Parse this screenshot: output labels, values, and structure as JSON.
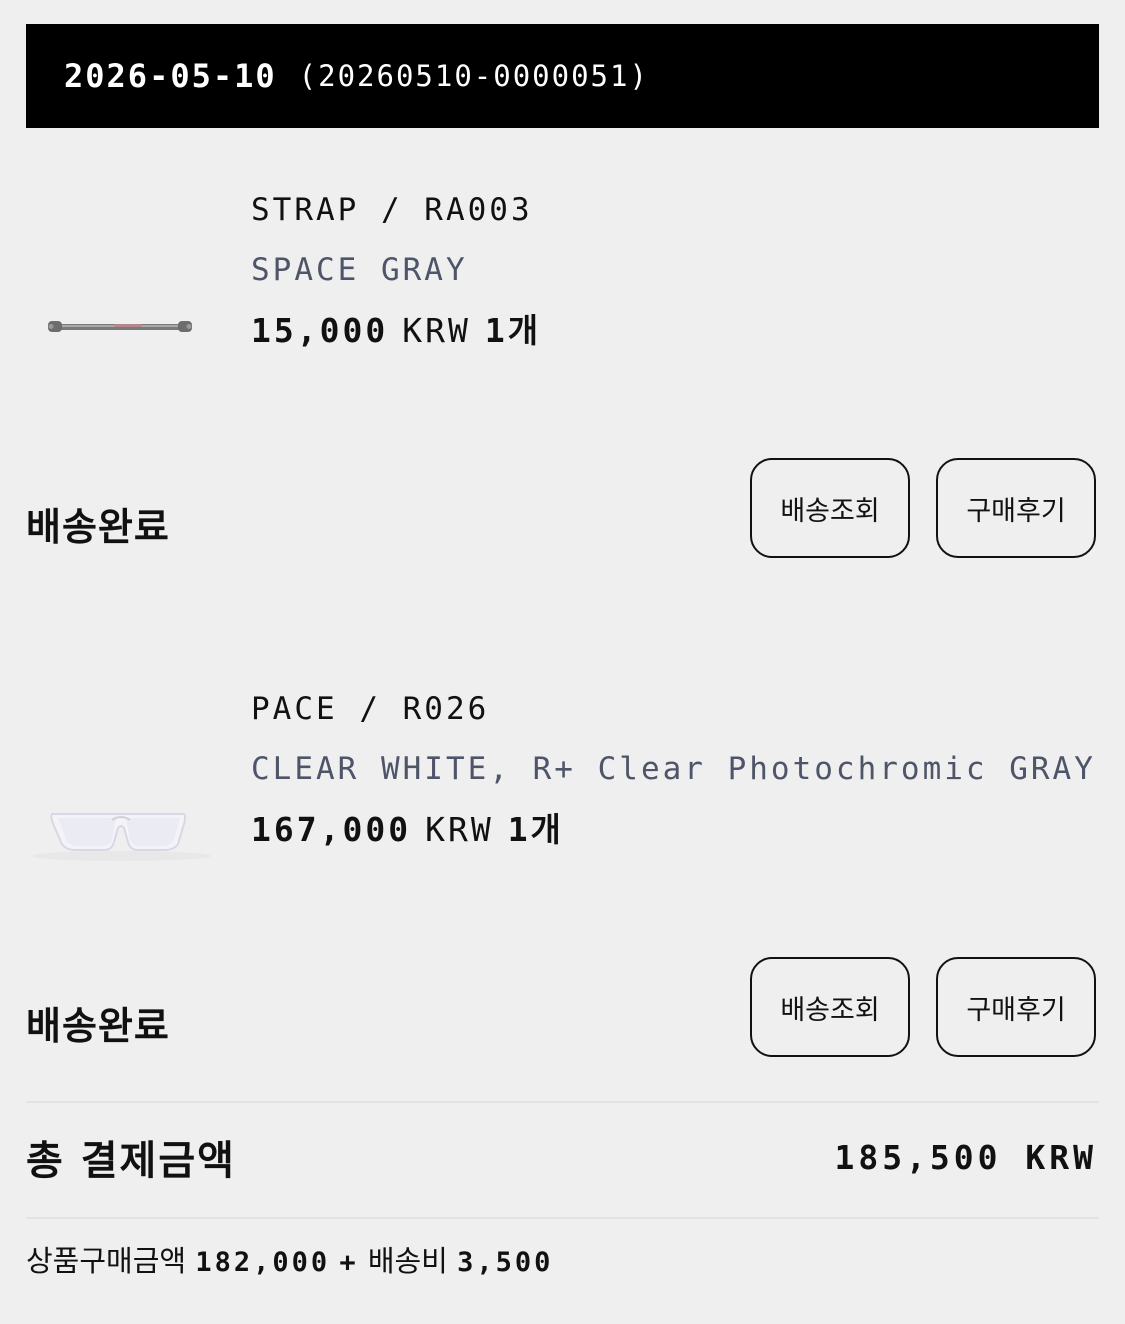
{
  "order": {
    "date": "2026-05-10",
    "number": "(20260510-0000051)"
  },
  "items": [
    {
      "name": "STRAP / RA003",
      "option": "SPACE GRAY",
      "price": "15,000",
      "currency": "KRW",
      "quantity": "1개",
      "thumbnail_icon": "strap-image",
      "status": "배송완료",
      "track_label": "배송조회",
      "review_label": "구매후기"
    },
    {
      "name": "PACE / R026",
      "option": "CLEAR WHITE, R+ Clear Photochromic GRAY",
      "price": "167,000",
      "currency": "KRW",
      "quantity": "1개",
      "thumbnail_icon": "sunglasses-image",
      "status": "배송완료",
      "track_label": "배송조회",
      "review_label": "구매후기"
    }
  ],
  "summary": {
    "total_label": "총 결제금액",
    "total_amount": "185,500 KRW",
    "products_label": "상품구매금액",
    "products_amount": "182,000",
    "plus": "+",
    "shipping_label": "배송비",
    "shipping_amount": "3,500"
  }
}
